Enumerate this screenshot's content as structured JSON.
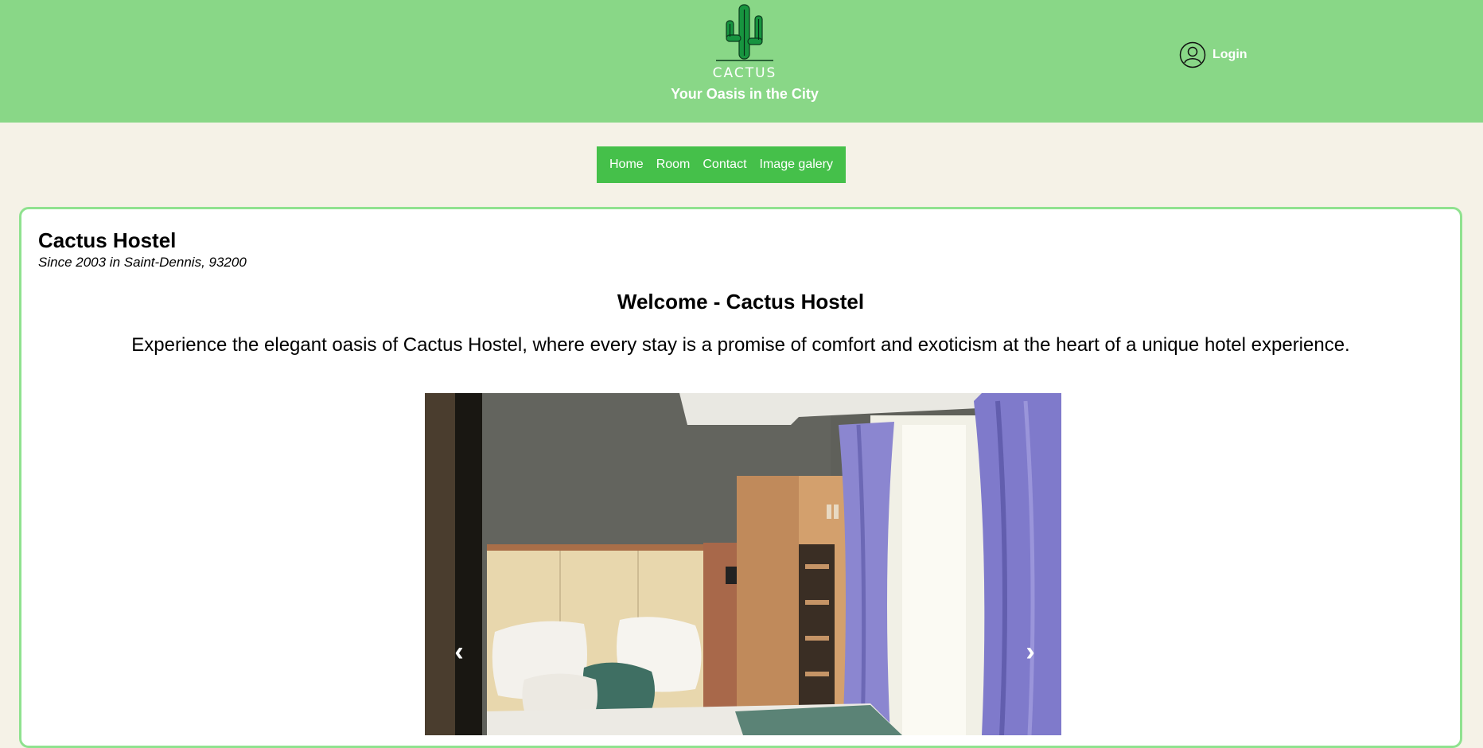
{
  "header": {
    "brand": "CACTUS",
    "tagline": "Your Oasis in the City",
    "login_label": "Login",
    "colors": {
      "background": "#89d787",
      "cactus": "#1e9a45"
    }
  },
  "nav": {
    "items": [
      {
        "label": "Home"
      },
      {
        "label": "Room"
      },
      {
        "label": "Contact"
      },
      {
        "label": "Image galery"
      }
    ],
    "background": "#45c04a"
  },
  "main": {
    "title": "Cactus Hostel",
    "subtitle": "Since 2003 in Saint-Dennis, 93200",
    "heading": "Welcome - Cactus Hostel",
    "intro": "Experience the elegant oasis of Cactus Hostel, where every stay is a promise of comfort and exoticism at the heart of a unique hotel experience.",
    "carousel": {
      "prev_icon": "‹",
      "next_icon": "›",
      "image_subject": "hotel-room-photo"
    }
  }
}
